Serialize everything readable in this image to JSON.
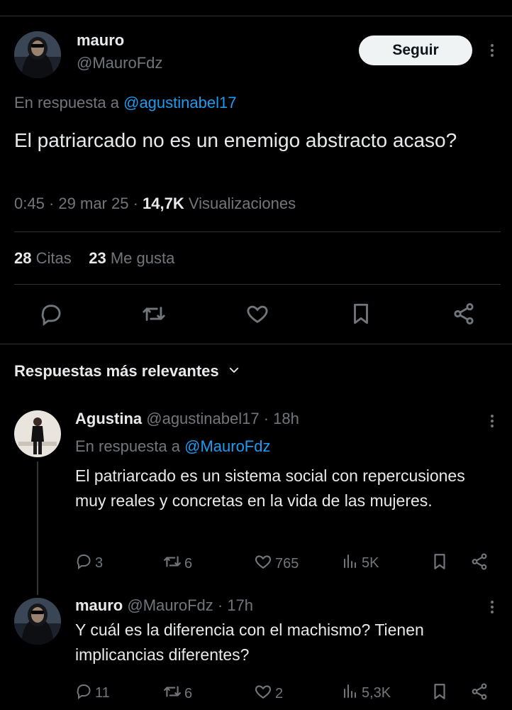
{
  "main_tweet": {
    "author_name": "mauro",
    "handle": "@MauroFdz",
    "follow_label": "Seguir",
    "reply_prefix": "En respuesta a",
    "reply_to": "@agustinabel17",
    "text": "El patriarcado no es un enemigo abstracto acaso?",
    "time": "0:45",
    "sep1": "·",
    "date": "29 mar 25",
    "sep2": "·",
    "views_count": "14,7K",
    "views_label": "Visualizaciones",
    "quotes_count": "28",
    "quotes_label": "Citas",
    "likes_count": "23",
    "likes_label": "Me gusta"
  },
  "sort": {
    "label": "Respuestas más relevantes"
  },
  "replies": [
    {
      "author_name": "Agustina",
      "handle": "@agustinabel17",
      "time": "· 18h",
      "reply_prefix": "En respuesta a",
      "reply_to": "@MauroFdz",
      "text": "El patriarcado es un sistema social con repercusiones muy reales y concretas en la vida de las mujeres.",
      "replies": "3",
      "reposts": "6",
      "likes": "765",
      "views": "5K"
    },
    {
      "author_name": "mauro",
      "handle": "@MauroFdz",
      "time": "· 17h",
      "text": "Y cuál es la diferencia con el machismo? Tienen implicancias diferentes?",
      "replies": "11",
      "reposts": "6",
      "likes": "2",
      "views": "5,3K"
    }
  ],
  "colors": {
    "accent": "#1d9bf0",
    "muted": "#71767b",
    "text": "#e7e9ea",
    "border": "#2f3336"
  },
  "icons": [
    "more-icon",
    "reply-icon",
    "repost-icon",
    "like-icon",
    "bookmark-icon",
    "share-icon",
    "views-icon",
    "chevron-down-icon"
  ]
}
